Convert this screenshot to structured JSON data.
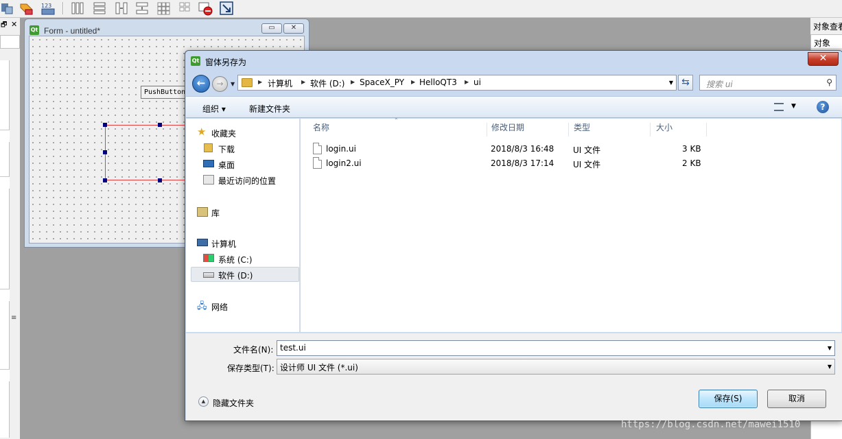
{
  "designer": {
    "form_title": "Form - untitled*",
    "push_button_label": "PushButton",
    "dock_float_glyph": "🗗",
    "dock_close_glyph": "✕",
    "object_inspector_title": "对象查看",
    "object_column": "对象",
    "minimize_glyph": "▭",
    "close_glyph": "✕"
  },
  "dialog": {
    "title": "窗体另存为",
    "close_glyph": "✕",
    "back_glyph": "←",
    "forward_glyph": "→",
    "breadcrumb": [
      "计算机",
      "软件 (D:)",
      "SpaceX_PY",
      "HelloQT3",
      "ui"
    ],
    "search_placeholder": "搜索 ui",
    "toolbar": {
      "organize": "组织 ▾",
      "new_folder": "新建文件夹",
      "help": "?"
    },
    "nav": {
      "favorites": "收藏夹",
      "downloads": "下载",
      "desktop": "桌面",
      "recent": "最近访问的位置",
      "libraries": "库",
      "computer": "计算机",
      "system_c": "系统 (C:)",
      "software_d": "软件 (D:)",
      "network": "网络"
    },
    "columns": {
      "name": "名称",
      "modified": "修改日期",
      "type": "类型",
      "size": "大小"
    },
    "files": [
      {
        "name": "login.ui",
        "modified": "2018/8/3 16:48",
        "type": "UI 文件",
        "size": "3 KB"
      },
      {
        "name": "login2.ui",
        "modified": "2018/8/3 17:14",
        "type": "UI 文件",
        "size": "2 KB"
      }
    ],
    "filename_label": "文件名(N):",
    "filename_value": "test.ui",
    "filetype_label": "保存类型(T):",
    "filetype_value": "设计师 UI 文件 (*.ui)",
    "hide_folders": "隐藏文件夹",
    "save_button": "保存(S)",
    "cancel_button": "取消"
  },
  "watermark": "https://blog.csdn.net/mawei1510"
}
